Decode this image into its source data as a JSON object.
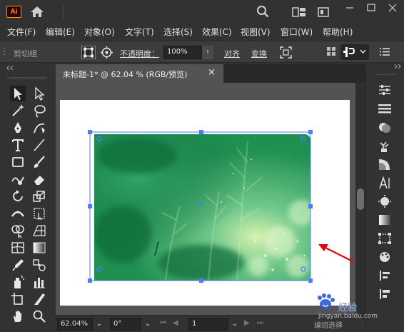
{
  "app": {
    "logo": "Ai"
  },
  "menu": [
    "文件(F)",
    "编辑(E)",
    "对象(O)",
    "文字(T)",
    "选择(S)",
    "效果(C)",
    "视图(V)",
    "窗口(W)",
    "帮助(H)"
  ],
  "control_bar": {
    "group_label": "剪切组",
    "opacity_label": "不透明度：",
    "opacity_value": "100%",
    "align_label": "对齐",
    "transform_label": "变换"
  },
  "document": {
    "tab_title": "未标题-1* @ 62.04 % (RGB/预览)",
    "close": "×"
  },
  "status": {
    "zoom": "62.04%",
    "rotation": "0°",
    "page": "1",
    "mode": "编组选择"
  },
  "watermark": {
    "brand": "经验",
    "url": "jingyan.baidu.com"
  },
  "colors": {
    "accent": "#ff9a00",
    "selection": "#4a7cff",
    "annotation_arrow": "#e60012"
  },
  "icons": {
    "tools": [
      "selection-tool",
      "direct-selection-tool",
      "magic-wand-tool",
      "lasso-tool",
      "pen-tool",
      "curvature-tool",
      "type-tool",
      "line-tool",
      "rectangle-tool",
      "paintbrush-tool",
      "shaper-tool",
      "eraser-tool",
      "rotate-tool",
      "scale-tool",
      "width-tool",
      "free-transform-tool",
      "shape-builder-tool",
      "perspective-grid-tool",
      "mesh-tool",
      "gradient-tool",
      "eyedropper-tool",
      "blend-tool",
      "symbol-sprayer-tool",
      "column-graph-tool",
      "artboard-tool",
      "slice-tool",
      "hand-tool",
      "zoom-tool"
    ],
    "right_panel": [
      "properties-icon",
      "layers-icon",
      "appearance-icon",
      "libraries-icon",
      "gradient-panel-icon",
      "character-icon",
      "color-icon",
      "transparency-icon",
      "align-panel-icon",
      "artboards-icon",
      "graphic-styles-icon",
      "align-left-icon"
    ]
  }
}
